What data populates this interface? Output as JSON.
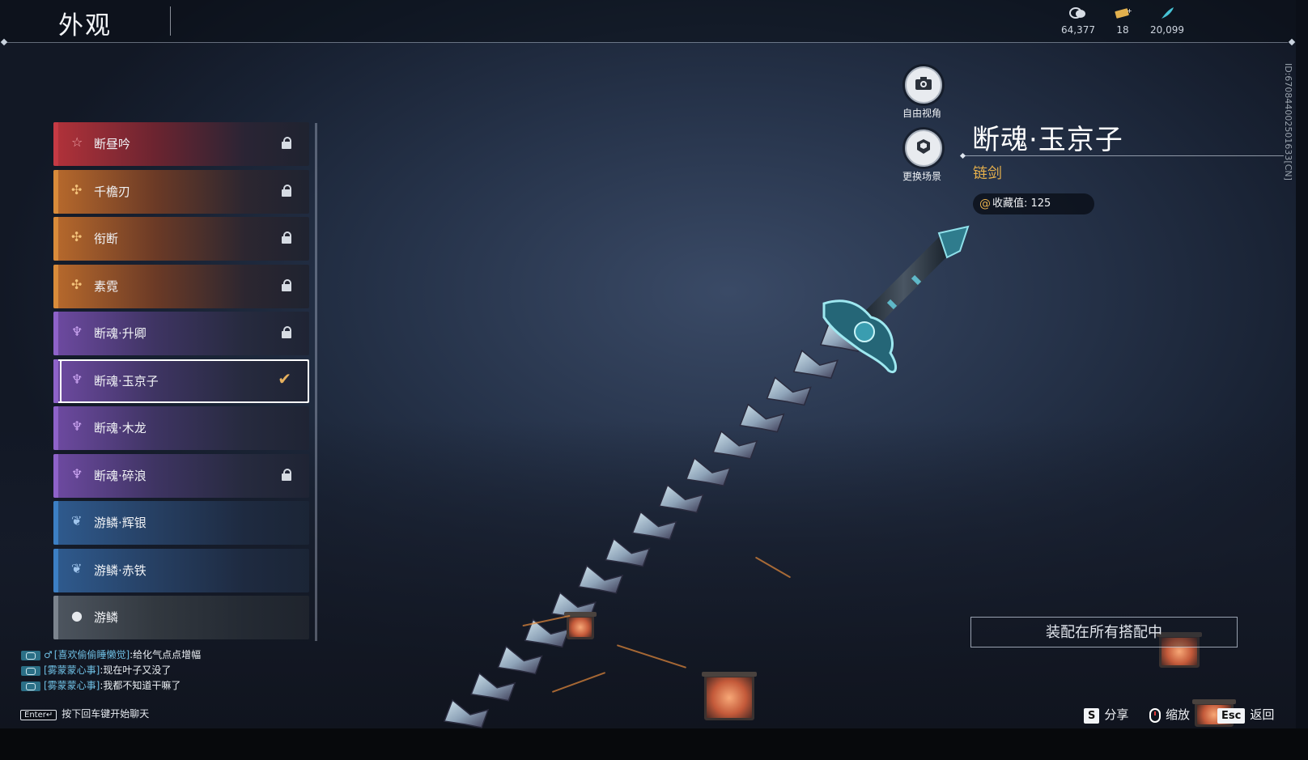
{
  "header": {
    "title": "外观",
    "currencies": [
      {
        "icon": "coin-stack-icon",
        "value": "64,377"
      },
      {
        "icon": "ticket-icon",
        "value": "18"
      },
      {
        "icon": "feather-icon",
        "value": "20,099"
      }
    ]
  },
  "skins": [
    {
      "name": "断昼吟",
      "rarity": "red",
      "icon": "star-icon",
      "locked": true,
      "selected": false
    },
    {
      "name": "千檐刃",
      "rarity": "orange",
      "icon": "cross-flower-icon",
      "locked": true,
      "selected": false
    },
    {
      "name": "衔断",
      "rarity": "orange",
      "icon": "cross-flower-icon",
      "locked": true,
      "selected": false
    },
    {
      "name": "素霓",
      "rarity": "orange",
      "icon": "cross-flower-icon",
      "locked": true,
      "selected": false
    },
    {
      "name": "断魂·升卿",
      "rarity": "purple",
      "icon": "triple-leaf-icon",
      "locked": true,
      "selected": false
    },
    {
      "name": "断魂·玉京子",
      "rarity": "purple",
      "icon": "triple-leaf-icon",
      "locked": false,
      "selected": true
    },
    {
      "name": "断魂·木龙",
      "rarity": "purple",
      "icon": "triple-leaf-icon",
      "locked": false,
      "selected": false
    },
    {
      "name": "断魂·碎浪",
      "rarity": "purple",
      "icon": "triple-leaf-icon",
      "locked": true,
      "selected": false
    },
    {
      "name": "游鳞·辉银",
      "rarity": "blue",
      "icon": "double-leaf-icon",
      "locked": false,
      "selected": false
    },
    {
      "name": "游鳞·赤铁",
      "rarity": "blue",
      "icon": "double-leaf-icon",
      "locked": false,
      "selected": false
    },
    {
      "name": "游鳞",
      "rarity": "gray",
      "icon": "drop-icon",
      "locked": false,
      "selected": false
    }
  ],
  "view_buttons": {
    "free_view": "自由视角",
    "change_scene": "更换场景"
  },
  "detail": {
    "name": "断魂·玉京子",
    "type": "链剑",
    "collect_label": "收藏值: 125",
    "id_text": "ID:670844002501633[CN]",
    "equip_label": "装配在所有搭配中"
  },
  "chat": {
    "messages": [
      {
        "user": "[喜欢偷偷睡懒觉]",
        "text": ":给化气点点增幅",
        "gender": "male-icon"
      },
      {
        "user": "[雾蒙蒙心事]",
        "text": ":现在叶子又没了",
        "gender": ""
      },
      {
        "user": "[雾蒙蒙心事]",
        "text": ":我都不知道干嘛了",
        "gender": ""
      }
    ],
    "enter_key": "Enter↵",
    "enter_hint": "按下回车键开始聊天"
  },
  "key_hints": {
    "share_key": "S",
    "share_label": "分享",
    "zoom_label": "缩放",
    "back_key": "Esc",
    "back_label": "返回"
  },
  "colors": {
    "accent_gold": "#e6b04c",
    "rarity_red": "#c53a44",
    "rarity_orange": "#d98b3a",
    "rarity_purple": "#8e62c9",
    "rarity_blue": "#3c7fc4",
    "rarity_gray": "#7c848e"
  }
}
